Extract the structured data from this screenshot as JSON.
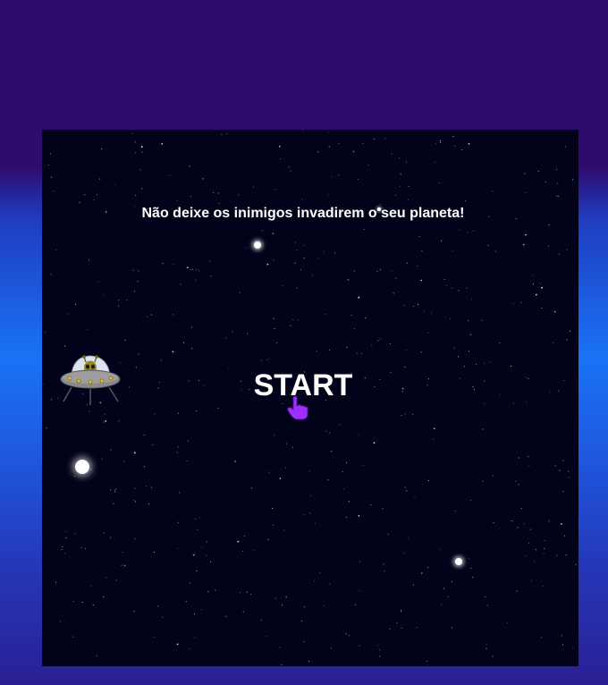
{
  "game": {
    "tagline": "Não deixe os inimigos invadirem o seu planeta!",
    "start_label": "START"
  },
  "icons": {
    "enemy": "ufo-alien-icon",
    "pointer": "hand-pointer-icon"
  },
  "colors": {
    "page_top": "#2f0b6e",
    "page_mid": "#1a73f5",
    "game_background": "#02021a",
    "text": "#ffffff",
    "pointer": "#9b30ff",
    "ufo_dome": "#dce4f2",
    "ufo_saucer": "#8a8a8a",
    "alien": "#8f8a2a"
  }
}
